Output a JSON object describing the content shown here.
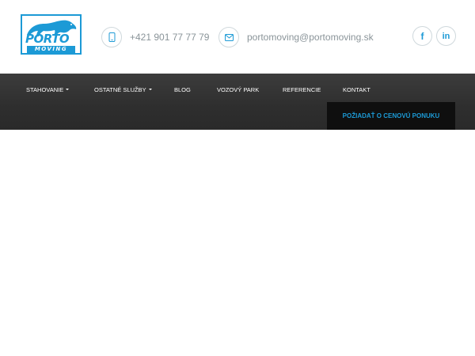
{
  "header": {
    "logo": {
      "word": "PORTO",
      "subword": "MOVING"
    },
    "phone": {
      "icon": "phone-icon",
      "text": "+421 901 77 77 79"
    },
    "email": {
      "icon": "envelope-icon",
      "text": "portomoving@portomoving.sk"
    },
    "social": [
      {
        "icon": "facebook-icon",
        "glyph": "f"
      },
      {
        "icon": "linkedin-icon",
        "glyph": "in"
      }
    ]
  },
  "nav": {
    "items": [
      {
        "label": "STAHOVANIE",
        "has_dropdown": true
      },
      {
        "label": "OSTATNÉ SLUŽBY",
        "has_dropdown": true
      },
      {
        "label": "BLOG",
        "has_dropdown": false
      },
      {
        "label": "VOZOVÝ PARK",
        "has_dropdown": false
      },
      {
        "label": "REFERENCIE",
        "has_dropdown": false
      },
      {
        "label": "KONTAKT",
        "has_dropdown": false
      }
    ],
    "cta_label": "POŽIADAŤ O CENOVÚ PONUKU"
  },
  "colors": {
    "accent": "#1c9ad6",
    "navbar": "#333333",
    "cta_background": "#0f0f0f",
    "muted_text": "#8a9499"
  }
}
